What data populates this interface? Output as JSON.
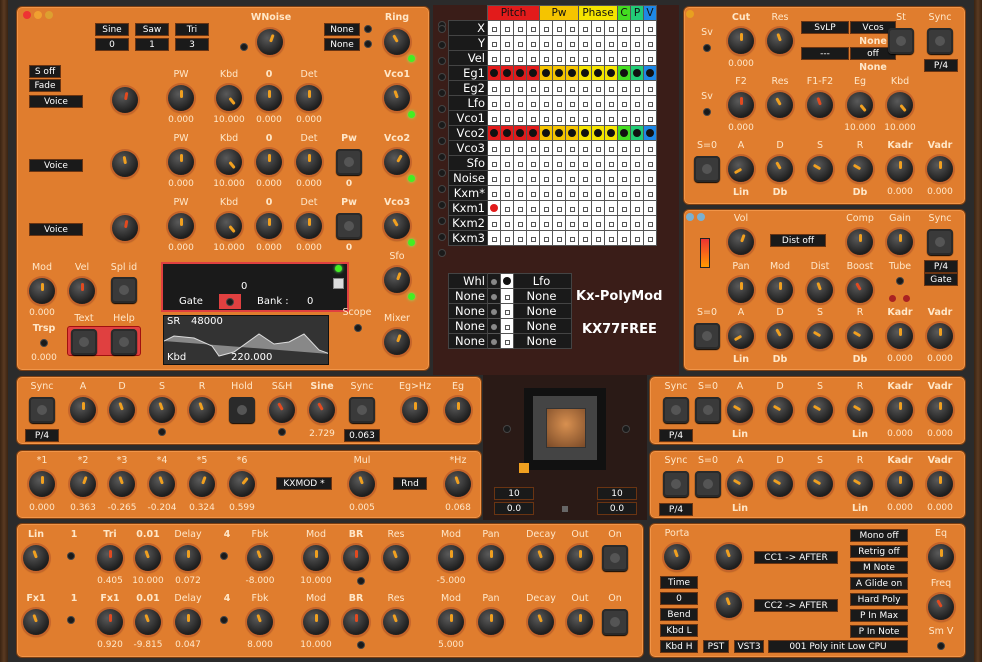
{
  "osc": {
    "waves": [
      "Sine",
      "Saw",
      "Tri"
    ],
    "wave_vals": [
      "0",
      "1",
      "3"
    ],
    "wnoise": "WNoise",
    "ring": "Ring",
    "ring_sel": [
      "None",
      "None"
    ],
    "soff": "S off",
    "fade": "Fade",
    "voice": "Voice",
    "cols": [
      "PW",
      "Kbd",
      "0",
      "Det"
    ],
    "vco": [
      "Vco1",
      "Vco2",
      "Vco3"
    ],
    "r1": [
      "0.000",
      "10.000",
      "0.000",
      "0.000"
    ],
    "r2": [
      "0.000",
      "10.000",
      "0.000",
      "0.000"
    ],
    "r3": [
      "0.000",
      "10.000",
      "0.000",
      "0.000"
    ],
    "pw": "Pw",
    "pwv": "0",
    "voice2": "Voice",
    "voice3": "Voice",
    "mod": "Mod",
    "vel": "Vel",
    "splid": "Spl id",
    "modv": "0.000",
    "trsp": "Trsp",
    "trspv": "0.000",
    "text": "Text",
    "help": "Help",
    "disp_num": "0",
    "gate": "Gate",
    "bank": "Bank :",
    "bankv": "0",
    "sr": "SR",
    "srv": "48000",
    "kbd": "Kbd",
    "kbdv": "220.000",
    "scope": "Scope",
    "sfo": "Sfo",
    "mixer": "Mixer"
  },
  "matrix": {
    "headers": [
      "Pitch",
      "Pw",
      "Phase",
      "C",
      "P",
      "V"
    ],
    "header_colors": [
      "#e21b1b",
      "#f5c400",
      "#f5e400",
      "#44dd22",
      "#22cc77",
      "#1e88e5"
    ],
    "rows": [
      "X",
      "Y",
      "Vel",
      "Eg1",
      "Eg2",
      "Lfo",
      "Vco1",
      "Vco2",
      "Vco3",
      "Sfo",
      "Noise",
      "Kxm*",
      "Kxm1",
      "Kxm2",
      "Kxm3"
    ]
  },
  "whl": {
    "rows": [
      "Whl",
      "None",
      "None",
      "None",
      "None"
    ],
    "dests": [
      "Lfo",
      "None",
      "None",
      "None",
      "None"
    ]
  },
  "brand": {
    "name": "Kx-PolyMod",
    "sub": "KX77FREE"
  },
  "filter": {
    "sv": "Sv",
    "cut": "Cut",
    "res": "Res",
    "svlp": "SvLP",
    "vcos": "Vcos",
    "none1": "None",
    "dash": "---",
    "off": "off",
    "none2": "None",
    "st": "St",
    "sync": "Sync",
    "p4": "P/4",
    "cutv": "0.000",
    "f2": "F2",
    "res2": "Res",
    "f1f2": "F1-F2",
    "eg": "Eg",
    "kbd": "Kbd",
    "r2": [
      "0.000",
      "10.000",
      "10.000"
    ],
    "s0": "S=0",
    "adsr": [
      "A",
      "D",
      "S",
      "R"
    ],
    "kadr": "Kadr",
    "vadr": "Vadr",
    "lin": "Lin",
    "db": "Db",
    "db2": "Db",
    "kv": [
      "0.000",
      "0.000"
    ]
  },
  "amp": {
    "vol": "Vol",
    "dist": "Dist off",
    "comp": "Comp",
    "gain": "Gain",
    "sync": "Sync",
    "pan": "Pan",
    "mod": "Mod",
    "dist2": "Dist",
    "boost": "Boost",
    "tube": "Tube",
    "p4gate": "P/4\nGate",
    "p4": "P/4",
    "gate": "Gate",
    "s0": "S=0",
    "adsr": [
      "A",
      "D",
      "S",
      "R"
    ],
    "kadr": "Kadr",
    "vadr": "Vadr",
    "lin": "Lin",
    "db": "Db",
    "db2": "Db",
    "kv": [
      "0.000",
      "0.000"
    ]
  },
  "lfo": {
    "sync": "Sync",
    "adsr": [
      "A",
      "D",
      "S",
      "R"
    ],
    "hold": "Hold",
    "sh": "S&H",
    "sine": "Sine",
    "sync2": "Sync",
    "eghz": "Eg>Hz",
    "eg": "Eg",
    "p4": "P/4",
    "v1": "2.729",
    "v2": "0.063"
  },
  "kxmod": {
    "labels": [
      "*1",
      "*2",
      "*3",
      "*4",
      "*5",
      "*6"
    ],
    "vals": [
      "0.000",
      "0.363",
      "-0.265",
      "-0.204",
      "0.324",
      "0.599"
    ],
    "name": "KXMOD *",
    "mul": "Mul",
    "mulv": "0.005",
    "rnd": "Rnd",
    "hz": "*Hz",
    "hzv": "0.068"
  },
  "center": {
    "n1": "10",
    "n2": "10",
    "v1": "0.0",
    "v2": "0.0"
  },
  "env3": {
    "sync": "Sync",
    "s0": "S=0",
    "adsr": [
      "A",
      "D",
      "S",
      "R"
    ],
    "kadr": "Kadr",
    "vadr": "Vadr",
    "p4": "P/4",
    "lin": "Lin",
    "kv": [
      "0.000",
      "0.000"
    ]
  },
  "env4": {
    "sync": "Sync",
    "s0": "S=0",
    "adsr": [
      "A",
      "D",
      "S",
      "R"
    ],
    "kadr": "Kadr",
    "vadr": "Vadr",
    "p4": "P/4",
    "lin": "Lin",
    "kv": [
      "0.000",
      "0.000"
    ]
  },
  "fx": {
    "row1": [
      "Lin",
      "1",
      "Tri",
      "0.01",
      "Delay",
      "4",
      "Fbk",
      "Mod",
      "BR",
      "Res",
      "Mod",
      "Pan",
      "Decay",
      "Out",
      "On"
    ],
    "row1v": [
      "0.405",
      "10.000",
      "0.072",
      "-8.000",
      "10.000",
      "-5.000"
    ],
    "row2": [
      "Fx1",
      "1",
      "Fx1",
      "0.01",
      "Delay",
      "4",
      "Fbk",
      "Mod",
      "BR",
      "Res",
      "Mod",
      "Pan",
      "Decay",
      "Out",
      "On"
    ],
    "row2v": [
      "0.920",
      "-9.815",
      "0.047",
      "8.000",
      "10.000",
      "5.000"
    ]
  },
  "perf": {
    "porta": "Porta",
    "time": "Time",
    "zero": "0",
    "bend": "Bend",
    "kbdl": "Kbd L",
    "kbdh": "Kbd H",
    "pst": "PST",
    "vst": "VST3",
    "preset": "001 Poly init Low CPU",
    "cc1": "CC1 -> AFTER",
    "cc2": "CC2 -> AFTER",
    "opts": [
      "Mono off",
      "Retrig off",
      "M Note",
      "A Glide on",
      "Hard Poly",
      "P In Max",
      "P In Note"
    ],
    "eq": "Eq",
    "freq": "Freq",
    "smv": "Sm V"
  }
}
